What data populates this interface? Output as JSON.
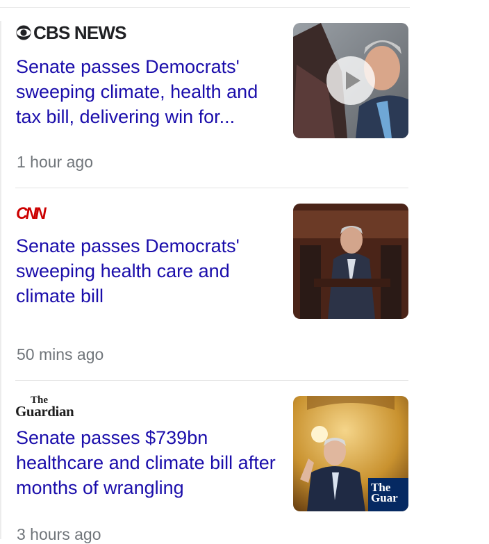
{
  "news": [
    {
      "source": "CBS NEWS",
      "headline": "Senate passes Democrats' sweeping climate, health and tax bill, delivering win for...",
      "time": "1 hour ago",
      "has_video": true
    },
    {
      "source": "CNN",
      "headline": "Senate passes Democrats' sweeping health care and climate bill",
      "time": "50 mins ago",
      "has_video": false
    },
    {
      "source": "The Guardian",
      "logo_the": "The",
      "logo_guardian": "Guardian",
      "headline": "Senate passes $739bn healthcare and climate bill after months of wrangling",
      "time": "3 hours ago",
      "has_video": false,
      "thumb_watermark": "The Guar"
    }
  ],
  "colors": {
    "headline": "#1a0dab",
    "time": "#70757a",
    "cnn_red": "#cc0000",
    "divider": "#e3e3e3"
  }
}
